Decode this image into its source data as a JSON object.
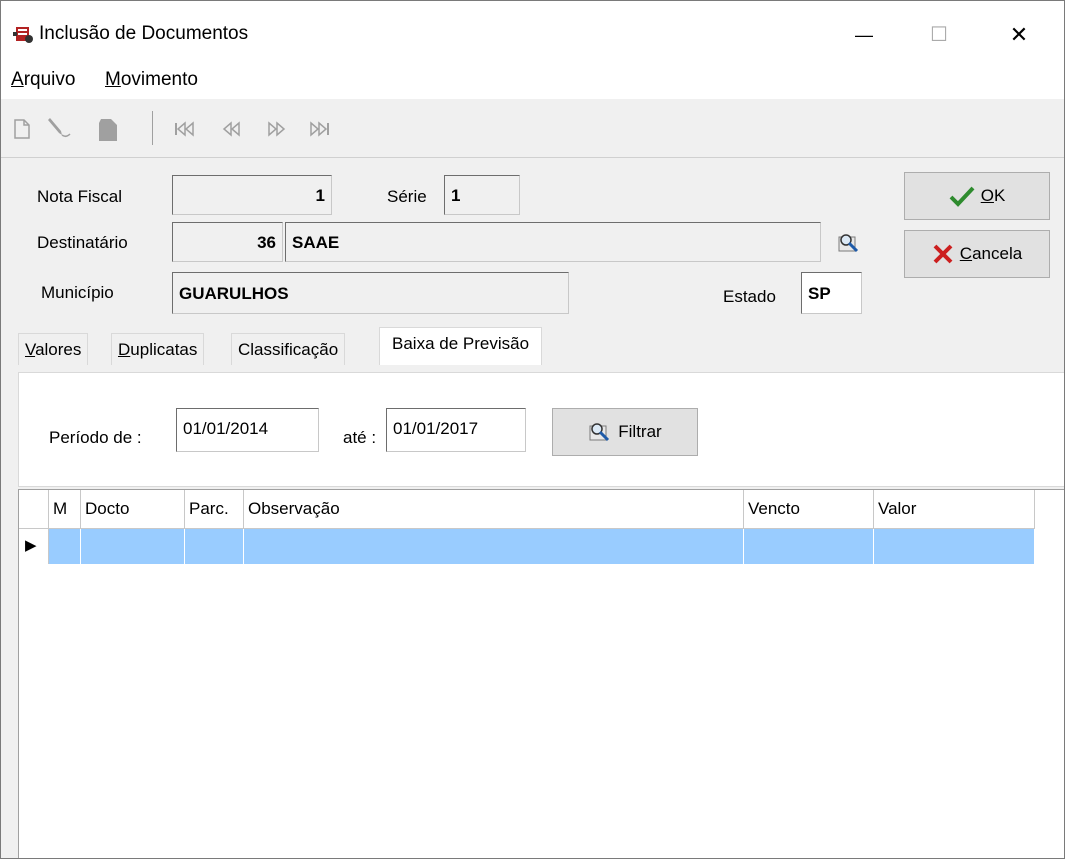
{
  "window": {
    "title": "Inclusão de Documentos",
    "controls": {
      "minimize": "—",
      "maximize": "☐",
      "close": "✕"
    }
  },
  "menu": [
    {
      "label": "Arquivo",
      "underline": "A",
      "rest": "rquivo"
    },
    {
      "label": "Movimento",
      "underline": "M",
      "rest": "ovimento"
    }
  ],
  "toolbar": {
    "icons": [
      "new-document-icon",
      "edit-pencil-icon",
      "delete-icon",
      "first-record-icon",
      "previous-record-icon",
      "next-record-icon",
      "last-record-icon"
    ],
    "glyphs": [
      "🗋",
      "✎",
      "⬢",
      "⏮",
      "⏪",
      "⏩",
      "⏭"
    ]
  },
  "header": {
    "nota_fiscal_label": "Nota Fiscal",
    "nota_fiscal_value": "1",
    "serie_label": "Série",
    "serie_value": "1",
    "destinatario_label": "Destinatário",
    "destinatario_code": "36",
    "destinatario_name": "SAAE",
    "municipio_label": "Município",
    "municipio_value": "GUARULHOS",
    "estado_label": "Estado",
    "estado_value": "SP"
  },
  "buttons": {
    "ok": {
      "mnemonic": "O",
      "rest": "K",
      "label": "OK"
    },
    "cancela": {
      "mnemonic": "C",
      "rest": "ancela",
      "label": "Cancela"
    }
  },
  "tabs": [
    {
      "label": "Valores",
      "mnemonic": "V",
      "rest": "alores"
    },
    {
      "label": "Duplicatas",
      "mnemonic": "D",
      "rest": "uplicatas"
    },
    {
      "label": "Classificação",
      "mnemonic": "",
      "rest": "Classificação"
    },
    {
      "label": "Baixa de Previsão",
      "mnemonic": "",
      "rest": "Baixa de Previsão",
      "active": true
    }
  ],
  "filter": {
    "periodo_label": "Período de :",
    "from": "01/01/2014",
    "ate_label": "até :",
    "to": "01/01/2017",
    "filtrar_label": "Filtrar"
  },
  "grid": {
    "columns": [
      "M",
      "Docto",
      "Parc.",
      "Observação",
      "Vencto",
      "Valor"
    ],
    "current_row_marker": "▶",
    "selection_color": "#99ccff"
  },
  "colors": {
    "accent_ok": "#2e8b2e",
    "cancel_x": "#cc1f1f",
    "window_bg": "#f0f0f0"
  }
}
